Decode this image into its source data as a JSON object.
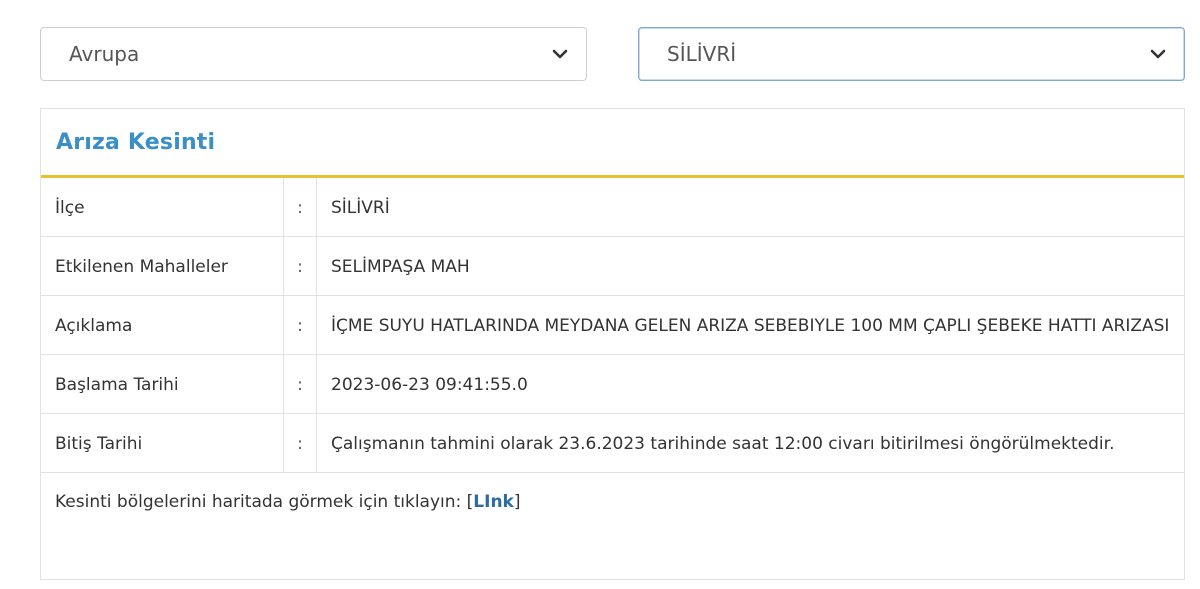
{
  "filters": {
    "region": {
      "selected": "Avrupa"
    },
    "district": {
      "selected": "SİLİVRİ"
    }
  },
  "panel": {
    "title": "Arıza Kesinti",
    "separator": ":",
    "rows": [
      {
        "label": "İlçe",
        "value": "SİLİVRİ"
      },
      {
        "label": "Etkilenen Mahalleler",
        "value": "SELİMPAŞA MAH"
      },
      {
        "label": "Açıklama",
        "value": "İÇME SUYU HATLARINDA MEYDANA GELEN ARIZA SEBEBIYLE 100 MM ÇAPLI ŞEBEKE HATTI ARIZASI"
      },
      {
        "label": "Başlama Tarihi",
        "value": "2023-06-23 09:41:55.0"
      },
      {
        "label": "Bitiş Tarihi",
        "value": "Çalışmanın tahmini olarak 23.6.2023 tarihinde saat 12:00 civarı bitirilmesi öngörülmektedir."
      }
    ],
    "footer": {
      "text": "Kesinti bölgelerini haritada görmek için tıklayın: ",
      "link_open": "[",
      "link_label": "LInk",
      "link_close": "]"
    }
  }
}
